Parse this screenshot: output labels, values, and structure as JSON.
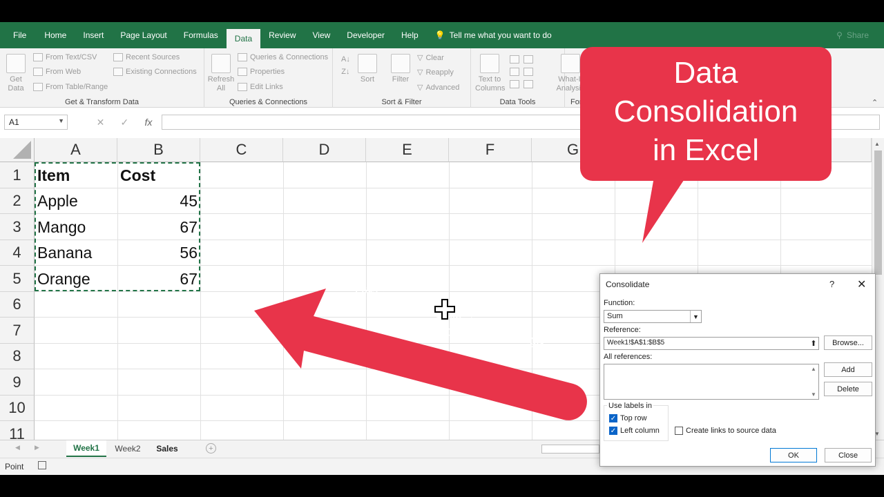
{
  "ribbon_tabs": [
    "File",
    "Home",
    "Insert",
    "Page Layout",
    "Formulas",
    "Data",
    "Review",
    "View",
    "Developer",
    "Help"
  ],
  "active_tab": "Data",
  "tell_me": "Tell me what you want to do",
  "share": "Share",
  "ribbon": {
    "get_data": [
      "Get",
      "Data"
    ],
    "get_transform": [
      "From Text/CSV",
      "From Web",
      "From Table/Range",
      "Recent Sources",
      "Existing Connections"
    ],
    "get_transform_label": "Get & Transform Data",
    "refresh": [
      "Refresh",
      "All"
    ],
    "queries": [
      "Queries & Connections",
      "Properties",
      "Edit Links"
    ],
    "queries_label": "Queries & Connections",
    "sort": "Sort",
    "filter": "Filter",
    "filter_items": [
      "Clear",
      "Reapply",
      "Advanced"
    ],
    "sort_filter_label": "Sort & Filter",
    "text_to_columns": [
      "Text to",
      "Columns"
    ],
    "data_tools_label": "Data Tools",
    "whatif": [
      "What-If",
      "Analysis"
    ],
    "forecast_label": "For"
  },
  "name_box": "A1",
  "fx": "fx",
  "columns": [
    "A",
    "B",
    "C",
    "D",
    "E",
    "F",
    "G"
  ],
  "rows": [
    "1",
    "2",
    "3",
    "4",
    "5",
    "6",
    "7",
    "8",
    "9",
    "10",
    "11"
  ],
  "cells": {
    "header": [
      "Item",
      "Cost"
    ],
    "data": [
      {
        "item": "Apple",
        "cost": "45"
      },
      {
        "item": "Mango",
        "cost": "67"
      },
      {
        "item": "Banana",
        "cost": "56"
      },
      {
        "item": "Orange",
        "cost": "67"
      }
    ]
  },
  "sheets": [
    "Week1",
    "Week2",
    "Sales"
  ],
  "active_sheet": "Week1",
  "status": "Point",
  "callout": [
    "Data",
    "Consolidation",
    "in Excel"
  ],
  "arrow_text": [
    "Highlighting the week 1 cell range",
    "with data"
  ],
  "dialog": {
    "title": "Consolidate",
    "help": "?",
    "function_label": "Function:",
    "function_value": "Sum",
    "reference_label": "Reference:",
    "reference_value": "Week1!$A$1:$B$5",
    "browse": "Browse...",
    "all_references_label": "All references:",
    "add": "Add",
    "delete": "Delete",
    "use_labels": "Use labels in",
    "top_row": "Top row",
    "left_column": "Left column",
    "create_links": "Create links to source data",
    "ok": "OK",
    "close": "Close"
  },
  "colors": {
    "excel_green": "#217346",
    "callout_red": "#e8344a",
    "dialog_blue": "#0a64c8"
  }
}
